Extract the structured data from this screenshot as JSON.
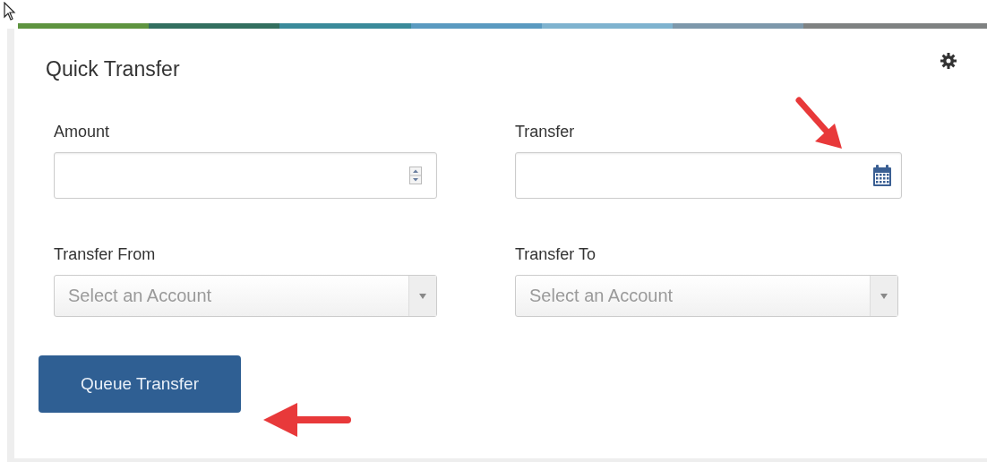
{
  "panel": {
    "title": "Quick Transfer"
  },
  "fields": [
    {
      "label": "Amount",
      "kind": "number"
    },
    {
      "label": "Transfer",
      "kind": "date"
    },
    {
      "label": "Transfer From",
      "kind": "select",
      "placeholder": "Select an Account"
    },
    {
      "label": "Transfer To",
      "kind": "select",
      "placeholder": "Select an Account"
    }
  ],
  "button": {
    "label": "Queue Transfer"
  }
}
